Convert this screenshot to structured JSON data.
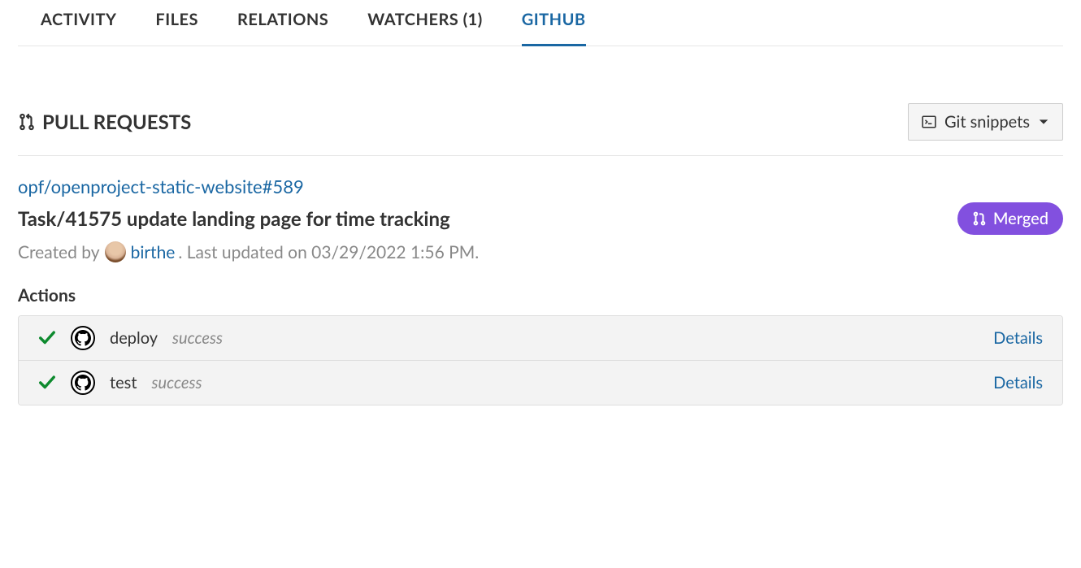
{
  "tabs": {
    "activity": "ACTIVITY",
    "files": "FILES",
    "relations": "RELATIONS",
    "watchers": "WATCHERS (1)",
    "github": "GITHUB"
  },
  "section_title": "PULL REQUESTS",
  "git_snippets_label": "Git snippets",
  "pr": {
    "link": "opf/openproject-static-website#589",
    "title": "Task/41575 update landing page for time tracking",
    "created_by_prefix": "Created by",
    "author": "birthe",
    "updated_suffix": ". Last updated on 03/29/2022 1:56 PM.",
    "merged_label": "Merged"
  },
  "actions_heading": "Actions",
  "actions": [
    {
      "name": "deploy",
      "status": "success",
      "details": "Details"
    },
    {
      "name": "test",
      "status": "success",
      "details": "Details"
    }
  ]
}
